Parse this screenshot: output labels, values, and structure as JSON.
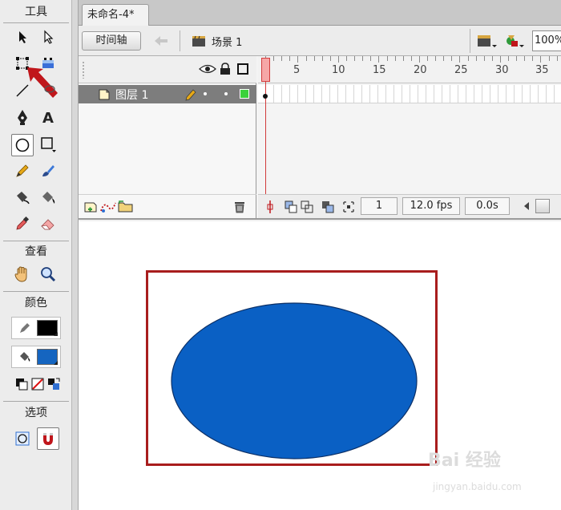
{
  "toolbar": {
    "header_tools": "工具",
    "header_view": "查看",
    "header_color": "颜色",
    "header_options": "选项",
    "stroke_color": "#000000",
    "fill_color": "#1565c0",
    "icons": [
      "selection-arrow",
      "subselection-arrow",
      "free-transform",
      "gradient-transform",
      "line",
      "lasso",
      "pen",
      "text",
      "oval",
      "rectangle",
      "pencil",
      "brush",
      "ink-bottle",
      "paint-bucket",
      "eyedropper",
      "eraser",
      "hand",
      "zoom"
    ]
  },
  "document": {
    "tab_title": "未命名-4*"
  },
  "editbar": {
    "timeline_button": "时间轴",
    "scene_label": "场景 1",
    "zoom": "100%"
  },
  "timeline": {
    "layer_name": "图层 1",
    "layer_color": "#3bd13b",
    "frame_numbers": [
      "1",
      "5",
      "10",
      "15",
      "20",
      "25",
      "30",
      "35"
    ],
    "current_frame": "1",
    "fps": "12.0 fps",
    "time": "0.0s"
  },
  "stage": {
    "ellipse_fill": "#0a60c4",
    "selection_color": "#a81d1d"
  },
  "watermark": {
    "text": "Bai 经验",
    "url": "jingyan.baidu.com"
  }
}
